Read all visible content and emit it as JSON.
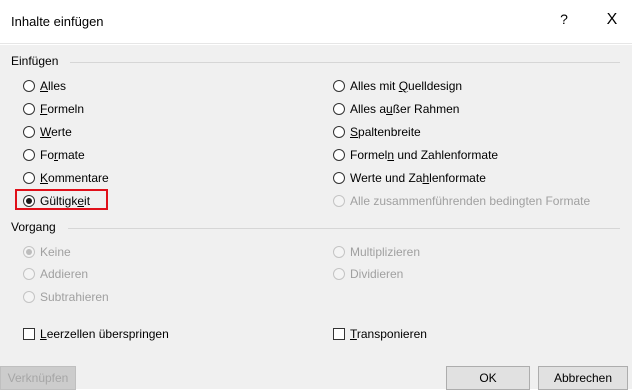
{
  "dialog": {
    "title": "Inhalte einfügen",
    "help": "?",
    "close": "X"
  },
  "insert_section": {
    "label": "Einfügen",
    "left_options": [
      {
        "label": "Alles",
        "checked": false
      },
      {
        "label": "Formeln",
        "checked": false
      },
      {
        "label": "Werte",
        "checked": false
      },
      {
        "label": "Formate",
        "checked": false
      },
      {
        "label": "Kommentare",
        "checked": false
      },
      {
        "label": "Gültigkeit",
        "checked": true
      }
    ],
    "right_options": [
      {
        "label": "Alles mit Quelldesign",
        "checked": false,
        "disabled": false
      },
      {
        "label": "Alles außer Rahmen",
        "checked": false,
        "disabled": false
      },
      {
        "label": "Spaltenbreite",
        "checked": false,
        "disabled": false
      },
      {
        "label": "Formeln und Zahlenformate",
        "checked": false,
        "disabled": false
      },
      {
        "label": "Werte und Zahlenformate",
        "checked": false,
        "disabled": false
      },
      {
        "label": "Alle zusammenführenden bedingten Formate",
        "checked": false,
        "disabled": true
      }
    ]
  },
  "operation_section": {
    "label": "Vorgang",
    "left_options": [
      {
        "label": "Keine",
        "checked": true
      },
      {
        "label": "Addieren",
        "checked": false
      },
      {
        "label": "Subtrahieren",
        "checked": false
      }
    ],
    "right_options": [
      {
        "label": "Multiplizieren",
        "checked": false
      },
      {
        "label": "Dividieren",
        "checked": false
      }
    ]
  },
  "checkboxes": {
    "skip_blanks": "Leerzellen überspringen",
    "transpose": "Transponieren"
  },
  "buttons": {
    "link": "Verknüpfen",
    "ok": "OK",
    "cancel": "Abbrechen"
  },
  "colors": {
    "highlight": "#e0101a",
    "dialog_bg": "#f0f0f0"
  }
}
